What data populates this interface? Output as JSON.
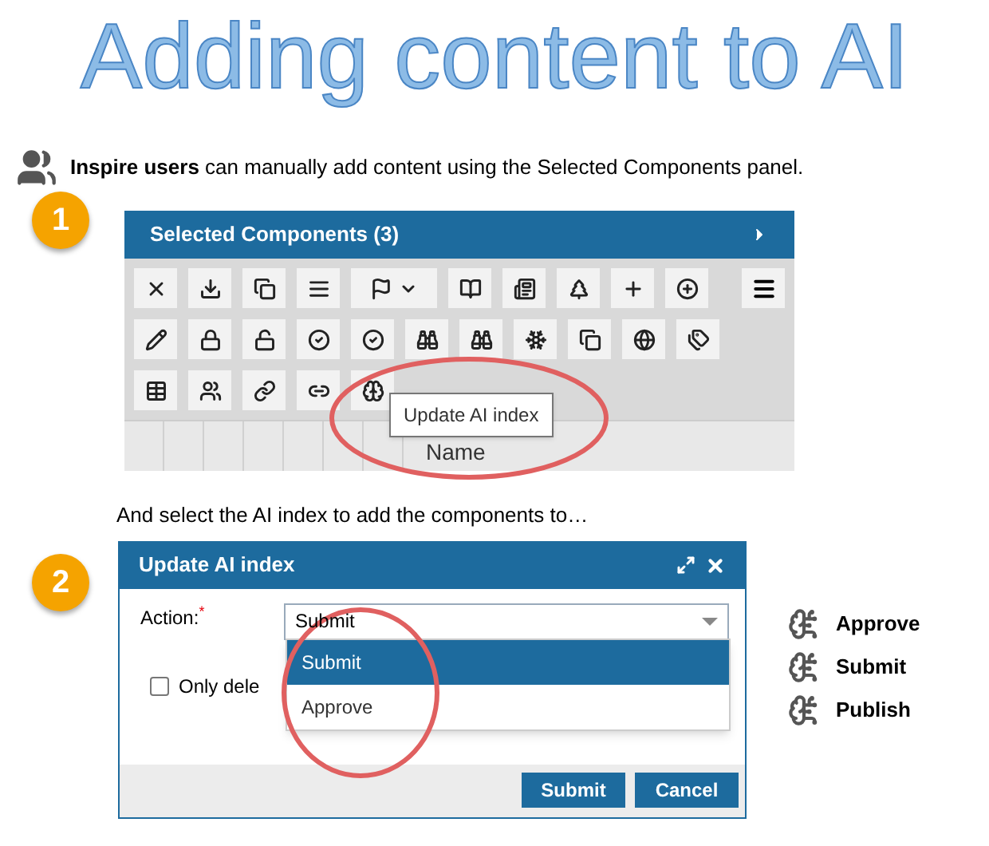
{
  "title": "Adding content to AI",
  "intro": "**Inspire users** can manually add content using the Selected Components panel.",
  "steps": [
    {
      "number": "1"
    },
    {
      "number": "2"
    }
  ],
  "panel": {
    "title": "Selected Components (3)",
    "tooltip": "Update AI index",
    "column": "Name"
  },
  "instruction": "And select the AI index to add the components to…",
  "dialog": {
    "title": "Update AI index",
    "field_label": "Action:",
    "required_mark": "*",
    "value": "Submit",
    "options": [
      {
        "label": "Submit",
        "selected": true
      },
      {
        "label": "Approve",
        "selected": false
      }
    ],
    "checkbox": {
      "label": "Only dele",
      "checked": false
    },
    "buttons": [
      "Submit",
      "Cancel"
    ]
  },
  "legend": [
    "Approve",
    "Submit",
    "Publish"
  ]
}
